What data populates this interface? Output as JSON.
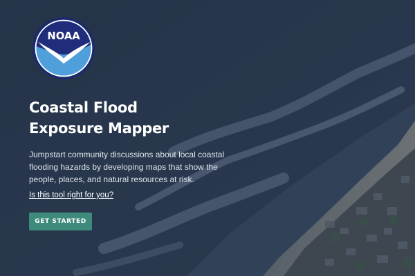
{
  "logo": {
    "text": "NOAA",
    "icon": "noaa-seagull-logo",
    "colors": {
      "ring": "#1a2a6c",
      "top": "#1f2d7a",
      "bottom": "#4f9fdb",
      "bird": "#ffffff"
    }
  },
  "hero": {
    "title": "Coastal Flood Exposure Mapper",
    "description": "Jumpstart community discussions about local coastal flooding hazards by developing maps that show the people, places, and natural resources at risk.",
    "help_link": "Is this tool right for you?",
    "cta_label": "GET STARTED"
  },
  "colors": {
    "overlay": "#2c3a50",
    "cta": "#3e8a7c",
    "text": "#ffffff"
  }
}
